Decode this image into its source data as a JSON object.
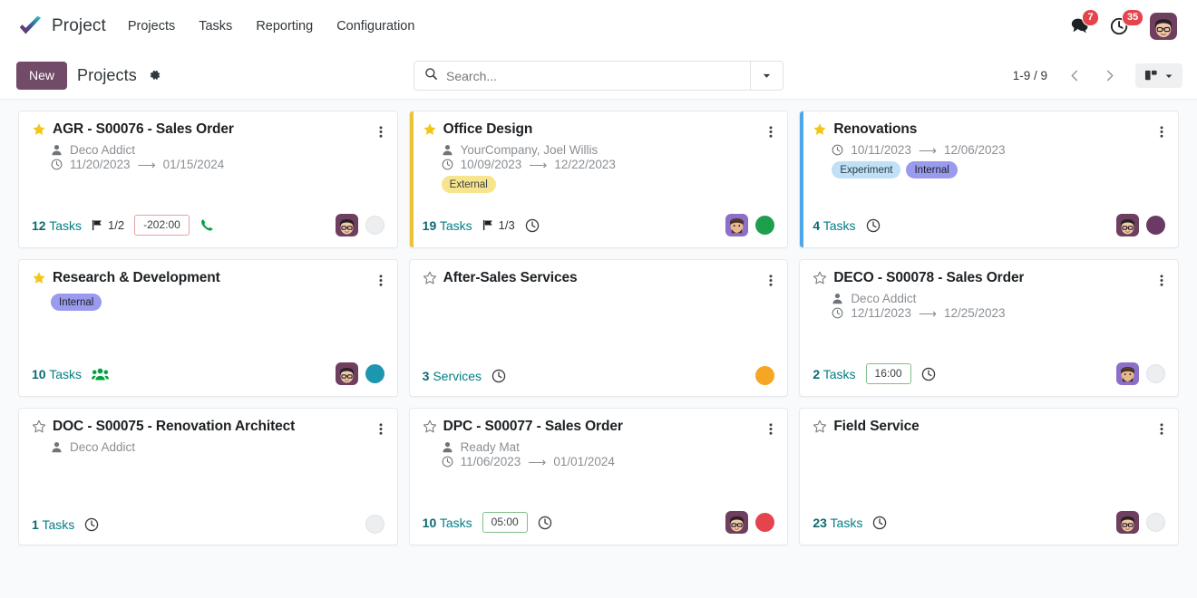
{
  "navbar": {
    "brand": "Project",
    "logo_icon": "check-logo-icon",
    "menu": [
      {
        "label": "Projects"
      },
      {
        "label": "Tasks"
      },
      {
        "label": "Reporting"
      },
      {
        "label": "Configuration"
      }
    ],
    "messages": {
      "icon": "messages-icon",
      "count": "7"
    },
    "activities": {
      "icon": "clock-activity-icon",
      "count": "35"
    },
    "avatar": {
      "icon": "user-avatar-icon"
    }
  },
  "control_panel": {
    "new_button": "New",
    "title": "Projects",
    "gear_icon": "gear-icon",
    "search": {
      "icon": "search-icon",
      "placeholder": "Search...",
      "value": "",
      "toggle_icon": "chevron-down-icon"
    },
    "pager": {
      "value": "1-9 / 9",
      "previous_icon": "chevron-left-icon",
      "next_icon": "chevron-right-icon"
    },
    "view_switcher": {
      "icon": "kanban-view-icon",
      "caret_icon": "caret-down-icon"
    }
  },
  "kanban": {
    "cards": [
      {
        "title": "AGR - S00076 - Sales Order",
        "starred": true,
        "stripe_color": "",
        "partner": "Deco Addict",
        "date_start": "11/20/2023",
        "date_end": "01/15/2024",
        "tags": [],
        "count_value": "12",
        "count_label": "Tasks",
        "flag": "1/2",
        "time_badge": "-202:00",
        "time_badge_state": "neg",
        "footer_icon": "phone-icon",
        "footer_icon_color": "#00a040",
        "has_avatar": true,
        "status_color": ""
      },
      {
        "title": "Office Design",
        "starred": true,
        "stripe_color": "#ebc335",
        "partner": "YourCompany, Joel Willis",
        "date_start": "10/09/2023",
        "date_end": "12/22/2023",
        "tags": [
          {
            "label": "External",
            "bg": "#f6e58c",
            "fg": "#3c4043"
          }
        ],
        "count_value": "19",
        "count_label": "Tasks",
        "flag": "1/3",
        "time_badge": "",
        "time_badge_state": "",
        "footer_icon": "clock-icon",
        "footer_icon_color": "#3c4043",
        "has_avatar": true,
        "status_color": "#1d9f4e"
      },
      {
        "title": "Renovations",
        "starred": true,
        "stripe_color": "#4ea6ea",
        "partner": "",
        "date_start": "10/11/2023",
        "date_end": "12/06/2023",
        "tags": [
          {
            "label": "Experiment",
            "bg": "#bfe0f5",
            "fg": "#2b3a45"
          },
          {
            "label": "Internal",
            "bg": "#9a9aee",
            "fg": "#1d2124"
          }
        ],
        "count_value": "4",
        "count_label": "Tasks",
        "flag": "",
        "time_badge": "",
        "time_badge_state": "",
        "footer_icon": "clock-icon",
        "footer_icon_color": "#3c4043",
        "has_avatar": true,
        "status_color": "#6b3a62"
      },
      {
        "title": "Research & Development",
        "starred": true,
        "stripe_color": "",
        "partner": "",
        "date_start": "",
        "date_end": "",
        "tags": [
          {
            "label": "Internal",
            "bg": "#9a9aee",
            "fg": "#1d2124"
          }
        ],
        "count_value": "10",
        "count_label": "Tasks",
        "flag": "",
        "time_badge": "",
        "time_badge_state": "",
        "footer_icon": "users-icon",
        "footer_icon_color": "#00a040",
        "has_avatar": true,
        "status_color": "#1d96b0"
      },
      {
        "title": "After-Sales Services",
        "starred": false,
        "stripe_color": "",
        "partner": "",
        "date_start": "",
        "date_end": "",
        "tags": [],
        "count_value": "3",
        "count_label": "Services",
        "flag": "",
        "time_badge": "",
        "time_badge_state": "",
        "footer_icon": "clock-icon",
        "footer_icon_color": "#3c4043",
        "has_avatar": false,
        "status_color": "#f5a623"
      },
      {
        "title": "DECO - S00078 - Sales Order",
        "starred": false,
        "stripe_color": "",
        "partner": "Deco Addict",
        "date_start": "12/11/2023",
        "date_end": "12/25/2023",
        "tags": [],
        "count_value": "2",
        "count_label": "Tasks",
        "flag": "",
        "time_badge": "16:00",
        "time_badge_state": "pos",
        "footer_icon": "clock-icon",
        "footer_icon_color": "#3c4043",
        "has_avatar": true,
        "status_color": ""
      },
      {
        "title": "DOC - S00075 - Renovation Architect",
        "starred": false,
        "stripe_color": "",
        "partner": "Deco Addict",
        "date_start": "",
        "date_end": "",
        "tags": [],
        "count_value": "1",
        "count_label": "Tasks",
        "flag": "",
        "time_badge": "",
        "time_badge_state": "",
        "footer_icon": "clock-icon",
        "footer_icon_color": "#3c4043",
        "has_avatar": false,
        "status_color": ""
      },
      {
        "title": "DPC - S00077 - Sales Order",
        "starred": false,
        "stripe_color": "",
        "partner": "Ready Mat",
        "date_start": "11/06/2023",
        "date_end": "01/01/2024",
        "tags": [],
        "count_value": "10",
        "count_label": "Tasks",
        "flag": "",
        "time_badge": "05:00",
        "time_badge_state": "pos",
        "footer_icon": "clock-icon",
        "footer_icon_color": "#3c4043",
        "has_avatar": true,
        "status_color": "#e4444c"
      },
      {
        "title": "Field Service",
        "starred": false,
        "stripe_color": "",
        "partner": "",
        "date_start": "",
        "date_end": "",
        "tags": [],
        "count_value": "23",
        "count_label": "Tasks",
        "flag": "",
        "time_badge": "",
        "time_badge_state": "",
        "footer_icon": "clock-icon",
        "footer_icon_color": "#3c4043",
        "has_avatar": true,
        "status_color": ""
      }
    ]
  },
  "theme": {
    "accent": "#714b67",
    "teal": "#017e84",
    "badge_red": "#e4444c"
  }
}
